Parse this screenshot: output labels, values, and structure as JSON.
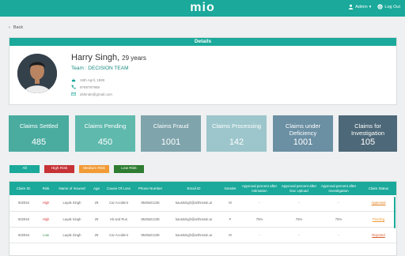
{
  "header": {
    "logo": "mio",
    "user_label": "Admin",
    "logout_label": "Log Out"
  },
  "nav": {
    "back_label": "Back"
  },
  "details": {
    "title": "Details",
    "name": "Harry Singh,",
    "age": "29 years",
    "team": "Team : DECISION TEAM",
    "dob": "15th April, 1990",
    "phone": "9768797969",
    "email": "dshinde@gmail.com"
  },
  "cards": [
    {
      "label": "Claims Settled",
      "value": "485",
      "color": "#4aab9f"
    },
    {
      "label": "Claims Pending",
      "value": "450",
      "color": "#5fb9ad"
    },
    {
      "label": "Claims Fraud",
      "value": "1001",
      "color": "#7fa4ac"
    },
    {
      "label": "Claims Processing",
      "value": "142",
      "color": "#9cc6cb"
    },
    {
      "label": "Claims under Deficiency",
      "value": "1001",
      "color": "#6b8fa3"
    },
    {
      "label": "Claims for Investigation",
      "value": "105",
      "color": "#4d6878"
    }
  ],
  "filters": [
    {
      "label": "All",
      "color": "#1aa99a"
    },
    {
      "label": "High Risk",
      "color": "#c63236"
    },
    {
      "label": "Medium Risk",
      "color": "#f29a35"
    },
    {
      "label": "Low Risk",
      "color": "#2e7d32"
    }
  ],
  "table": {
    "columns": [
      "Claim ID.",
      "Risk",
      "Name of Insured",
      "Age",
      "Cause Of Loss",
      "Phone Number",
      "Email ID",
      "Gender",
      "Approval percent after Intimation",
      "Approval percent after Doc Upload",
      "Approval percent after Investigation",
      "Claim Status"
    ],
    "rows": [
      [
        "502916",
        "High",
        "Layak Singh",
        "29",
        "Car Accident",
        "8545621236",
        "kaustsingh@arthreatic.ai",
        "M",
        "-",
        "-",
        "-",
        "Approved"
      ],
      [
        "502916",
        "High",
        "Layak Singh",
        "29",
        "Hit and Run",
        "8545621236",
        "kaustsingh@arthreatic.ai",
        "F",
        "75%",
        "75%",
        "75%",
        "Pending"
      ],
      [
        "502916",
        "Low",
        "Layak Singh",
        "29",
        "Car Accident",
        "8545621236",
        "kaustsingh@arthreatic.ai",
        "M",
        "-",
        "-",
        "-",
        "Rejected"
      ]
    ],
    "status_colors": {
      "Approved": "#e07b17",
      "Pending": "#f29a35",
      "Rejected": "#d95a2b"
    }
  }
}
